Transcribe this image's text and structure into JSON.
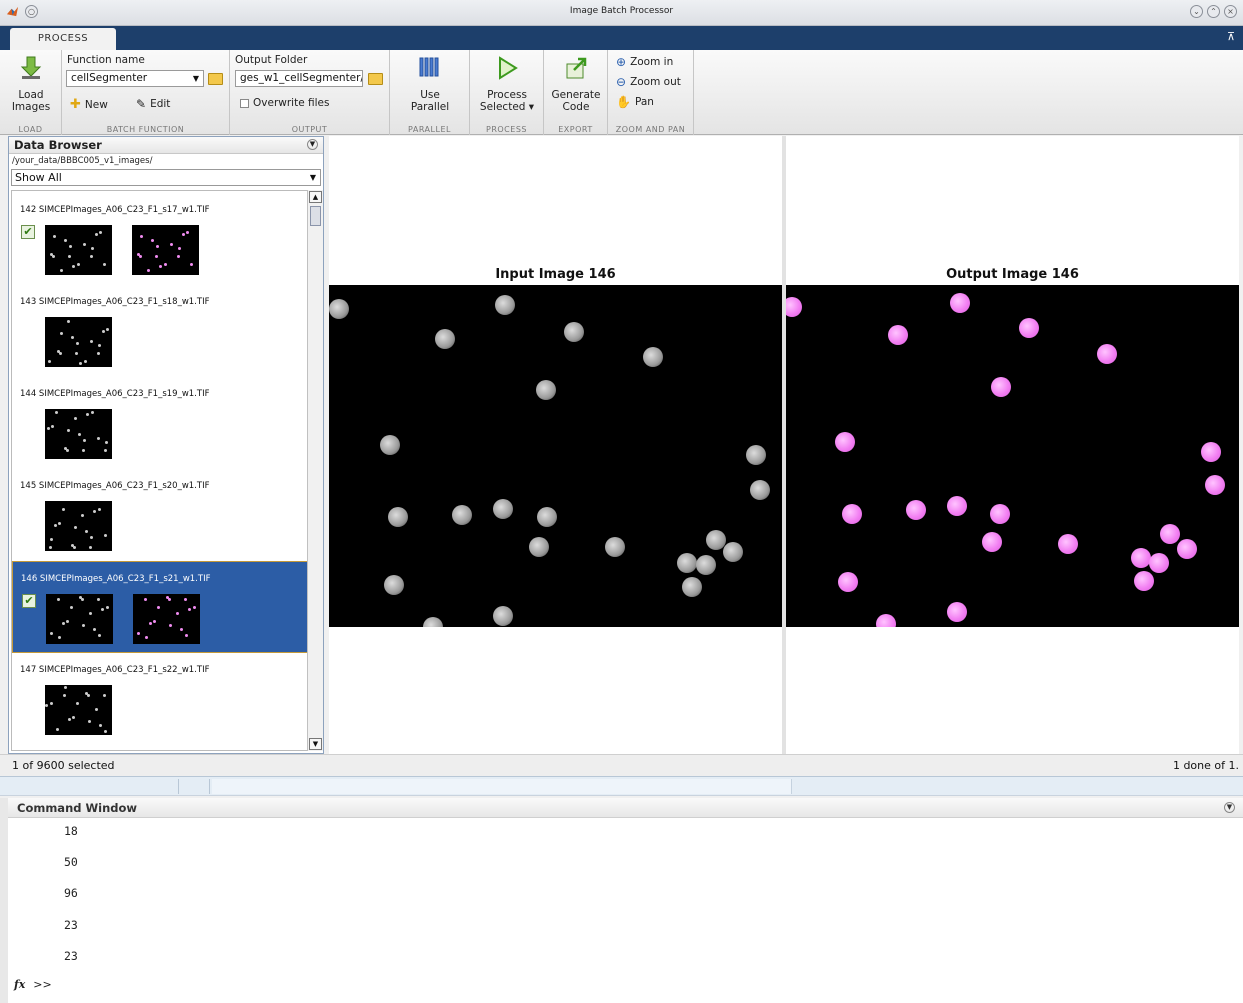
{
  "window": {
    "title": "Image Batch Processor"
  },
  "ribbon": {
    "tab": "PROCESS",
    "load": {
      "label1": "Load",
      "label2": "Images",
      "group": "LOAD"
    },
    "batch": {
      "function_label": "Function name",
      "function_value": "cellSegmenter",
      "new_label": "New",
      "edit_label": "Edit",
      "group": "BATCH FUNCTION"
    },
    "output": {
      "folder_label": "Output Folder",
      "folder_value": "ges_w1_cellSegmenter/",
      "overwrite_label": "Overwrite files",
      "group": "OUTPUT"
    },
    "parallel": {
      "label1": "Use",
      "label2": "Parallel",
      "group": "PARALLEL"
    },
    "process": {
      "label1": "Process",
      "label2": "Selected ▾",
      "group": "PROCESS"
    },
    "export": {
      "label1": "Generate",
      "label2": "Code",
      "group": "EXPORT"
    },
    "zoom": {
      "zoom_in": "Zoom in",
      "zoom_out": "Zoom out",
      "pan": "Pan",
      "group": "ZOOM AND PAN"
    }
  },
  "browser": {
    "title": "Data Browser",
    "path": "/your_data/BBBC005_v1_images/",
    "filter": "Show All",
    "items": [
      {
        "name": "142  SIMCEPImages_A06_C23_F1_s17_w1.TIF",
        "checked": true,
        "has_output": true,
        "selected": false
      },
      {
        "name": "143  SIMCEPImages_A06_C23_F1_s18_w1.TIF",
        "checked": false,
        "has_output": false,
        "selected": false
      },
      {
        "name": "144  SIMCEPImages_A06_C23_F1_s19_w1.TIF",
        "checked": false,
        "has_output": false,
        "selected": false
      },
      {
        "name": "145  SIMCEPImages_A06_C23_F1_s20_w1.TIF",
        "checked": false,
        "has_output": false,
        "selected": false
      },
      {
        "name": "146  SIMCEPImages_A06_C23_F1_s21_w1.TIF",
        "checked": true,
        "has_output": true,
        "selected": true
      },
      {
        "name": "147  SIMCEPImages_A06_C23_F1_s22_w1.TIF",
        "checked": false,
        "has_output": false,
        "selected": false
      }
    ]
  },
  "panels": {
    "input_title": "Input Image 146",
    "output_title": "Output Image 146"
  },
  "status": {
    "left": "1 of 9600 selected",
    "right": "1 done of 1."
  },
  "command_window": {
    "title": "Command Window",
    "outputs": [
      "18",
      "50",
      "96",
      "23",
      "23"
    ],
    "prompt": ">>",
    "fx": "fx"
  },
  "colors": {
    "ribbon_tab_bg": "#1d3f6b",
    "selection": "#2c5da6",
    "mask": "#f27ff2"
  }
}
